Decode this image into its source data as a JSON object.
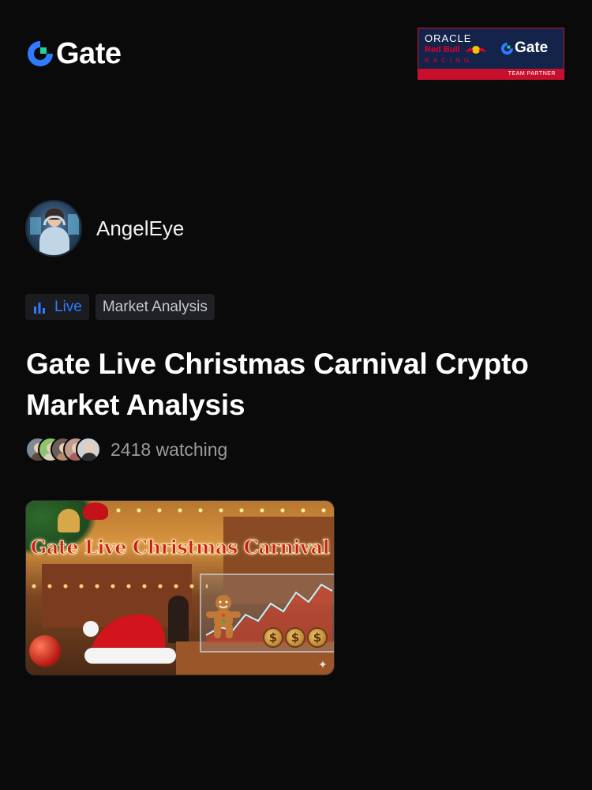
{
  "brand": {
    "name": "Gate",
    "accent": "#2f7bff"
  },
  "partner_banner": {
    "oracle": "ORACLE",
    "redbull": "Red Bull",
    "racing": "RACING",
    "gate": "Gate",
    "team_partner": "TEAM PARTNER"
  },
  "host": {
    "name": "AngelEye"
  },
  "tags": {
    "live": "Live",
    "category": "Market Analysis"
  },
  "stream": {
    "title": "Gate Live Christmas Carnival Crypto Market Analysis",
    "watching": "2418 watching"
  },
  "thumbnail": {
    "headline": "Gate Live Christmas Carnival",
    "coin_symbol": "$"
  },
  "icons": {
    "logo": "gate-logo-icon",
    "live": "bar-chart-icon",
    "sparkle": "sparkle-icon"
  }
}
